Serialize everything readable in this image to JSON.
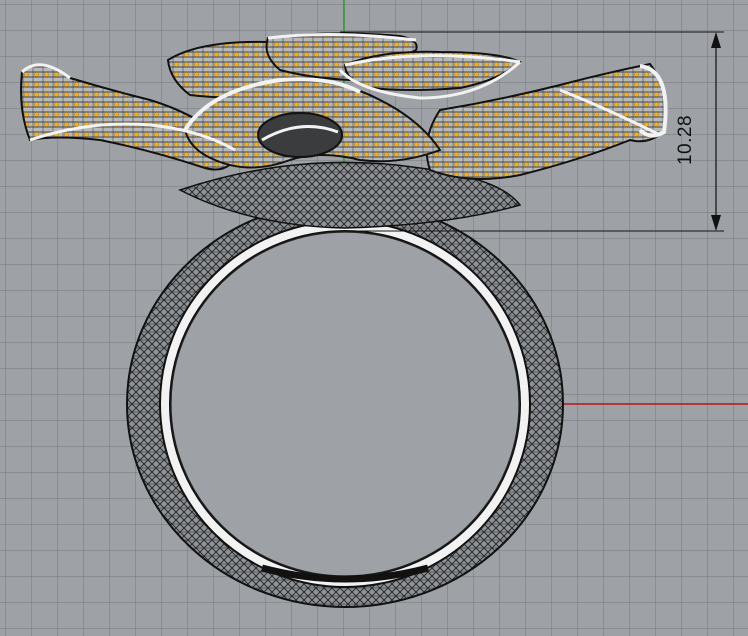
{
  "viewport": {
    "name": "Front",
    "background": "#9ea2a6",
    "grid_color": "#7a7e82",
    "axis_colors": {
      "x_axis": "#b01818",
      "y_axis": "#22a022"
    }
  },
  "dimension": {
    "value": "10.28",
    "color": "#111111"
  },
  "model": {
    "object": "flower-ring",
    "mesh_color": "#1a1a1a",
    "highlight_color": "#f0f0f0",
    "gem_color": "#f2b01e"
  }
}
